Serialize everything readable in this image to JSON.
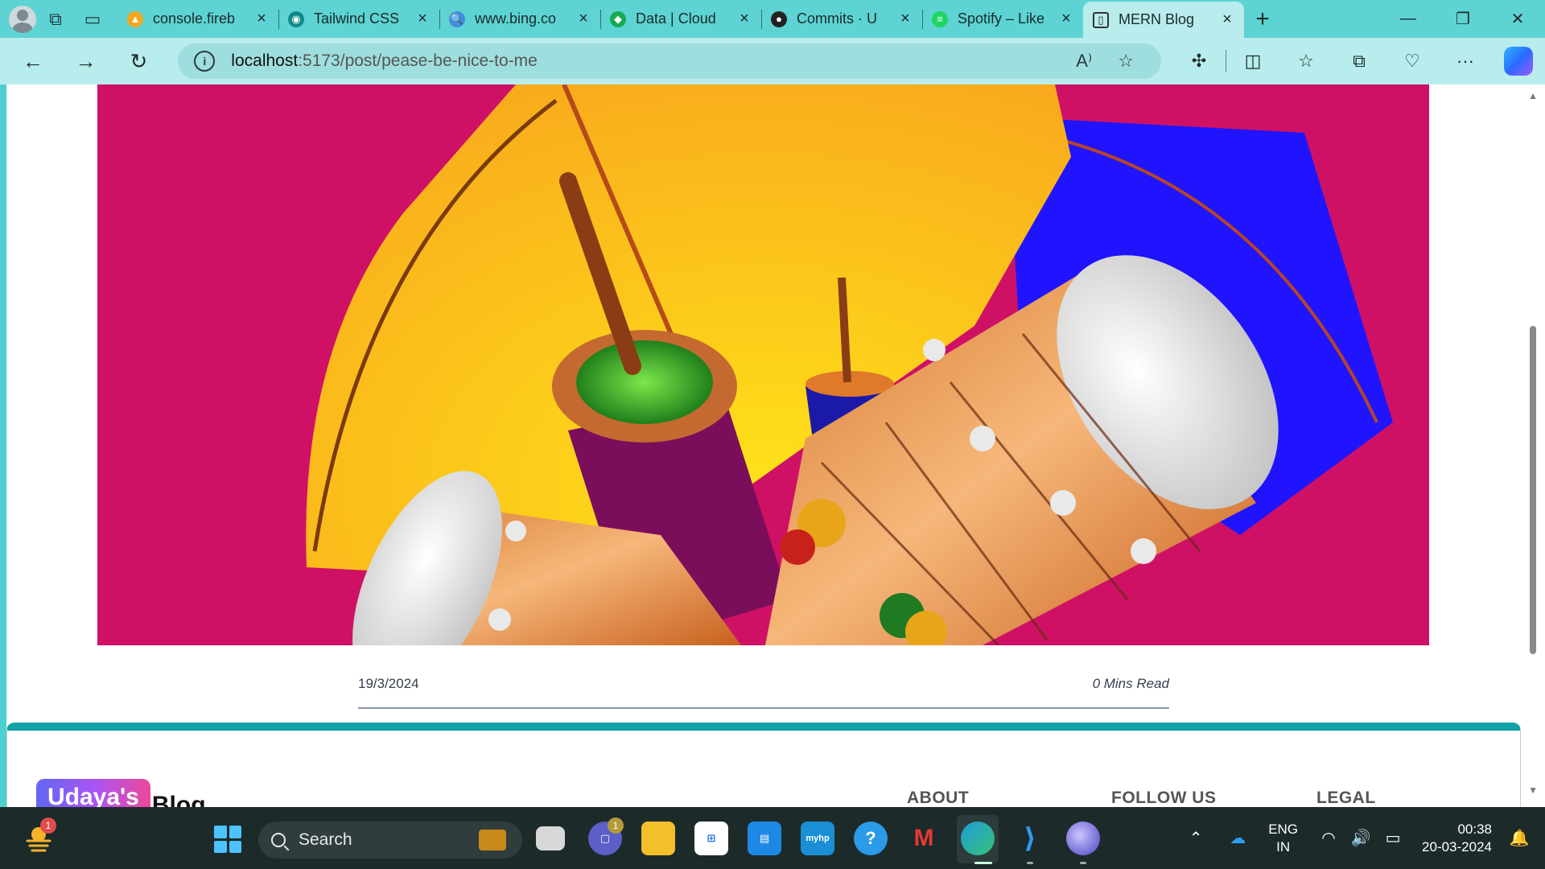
{
  "browser": {
    "tabs": [
      {
        "title": "console.fireb",
        "favicon_color": "#f2a81d",
        "favicon_glyph": "▲"
      },
      {
        "title": "Tailwind CSS",
        "favicon_color": "#0f8a8a",
        "favicon_glyph": "◉"
      },
      {
        "title": "www.bing.co",
        "favicon_color": "#3f8ede",
        "favicon_glyph": "🔍"
      },
      {
        "title": "Data | Cloud",
        "favicon_color": "#13aa52",
        "favicon_glyph": "◆"
      },
      {
        "title": "Commits · U",
        "favicon_color": "#222222",
        "favicon_glyph": "●"
      },
      {
        "title": "Spotify – Like",
        "favicon_color": "#1ed760",
        "favicon_glyph": "≡"
      },
      {
        "title": "MERN Blog",
        "favicon_color": "#b9ecec",
        "favicon_glyph": "▯"
      }
    ],
    "active_tab_index": 6,
    "url_host": "localhost",
    "url_path": ":5173/post/pease-be-nice-to-me"
  },
  "post": {
    "date": "19/3/2024",
    "read_time": "0 Mins Read",
    "hero_image": "festival-drums-kite-illustration"
  },
  "footer": {
    "brand_chip": "Udaya's",
    "brand_text": "Blog",
    "columns": [
      "ABOUT",
      "FOLLOW US",
      "LEGAL"
    ]
  },
  "taskbar": {
    "weather_badge": "1",
    "search_placeholder": "Search",
    "teams_badge": "1",
    "lang_line1": "ENG",
    "lang_line2": "IN",
    "time": "00:38",
    "date": "20-03-2024"
  },
  "colors": {
    "browser_frame": "#5ed3d3",
    "footer_accent": "#0fa3a7",
    "hero_background": "#cf1166"
  }
}
